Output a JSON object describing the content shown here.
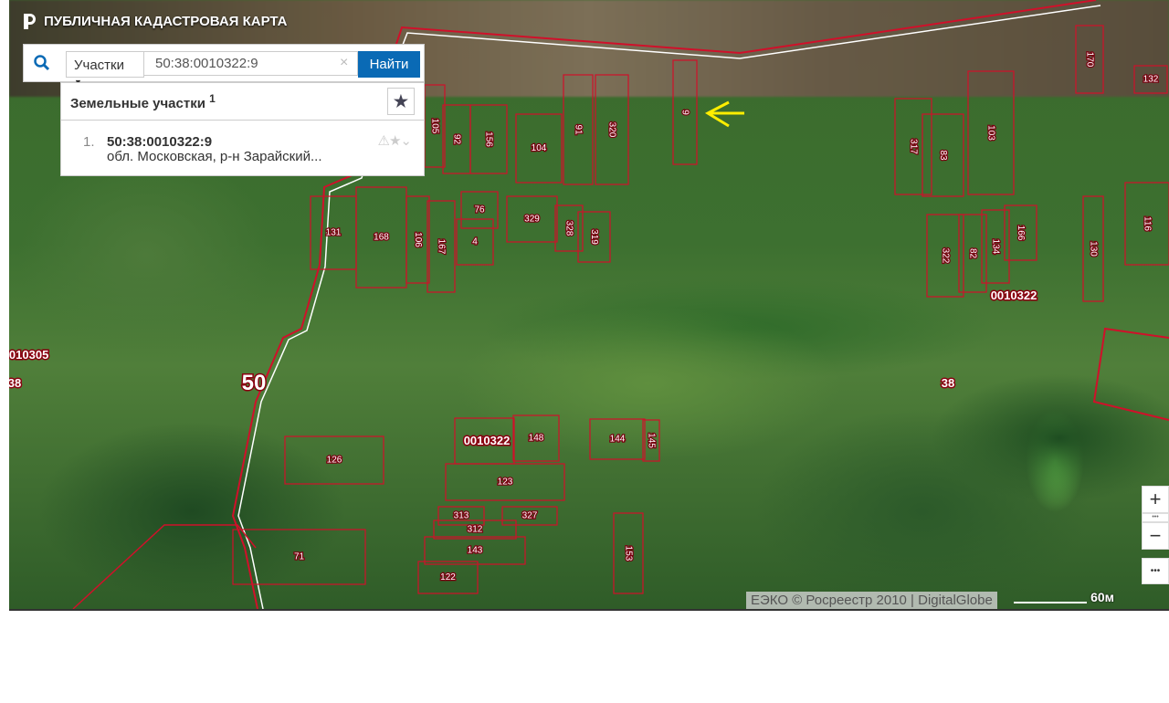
{
  "app": {
    "title": "ПУБЛИЧНАЯ КАДАСТРОВАЯ КАРТА",
    "logo_icon": "rosreestr-logo"
  },
  "search": {
    "type_label": "Участки",
    "query": "50:38:0010322:9",
    "clear_icon": "×",
    "find_label": "Найти"
  },
  "results": {
    "heading": "Земельные участки",
    "count": "1",
    "items": [
      {
        "num": "1.",
        "id": "50:38:0010322:9",
        "address": "обл. Московская, р-н Зарайский..."
      }
    ]
  },
  "map": {
    "parcels": [
      "9",
      "170",
      "132",
      "105",
      "92",
      "156",
      "104",
      "91",
      "320",
      "317",
      "83",
      "103",
      "116",
      "131",
      "168",
      "106",
      "167",
      "76",
      "4",
      "329",
      "328",
      "319",
      "322",
      "82",
      "134",
      "166",
      "130",
      "126",
      "132",
      "148",
      "144",
      "145",
      "123",
      "313",
      "327",
      "312",
      "143",
      "122",
      "153",
      "71"
    ],
    "block_labels": [
      "0010322",
      "0010322",
      "0010305",
      "38",
      "38"
    ],
    "district_label": "50",
    "accent_color": "#d0102a",
    "pointer_color": "#ffee00"
  },
  "attribution": "ЕЭКО © Росреестр 2010 | DigitalGlobe",
  "scale": "60м",
  "controls": {
    "zoom_in": "+",
    "zoom_out": "−",
    "more": "•••",
    "layers": "•••"
  }
}
